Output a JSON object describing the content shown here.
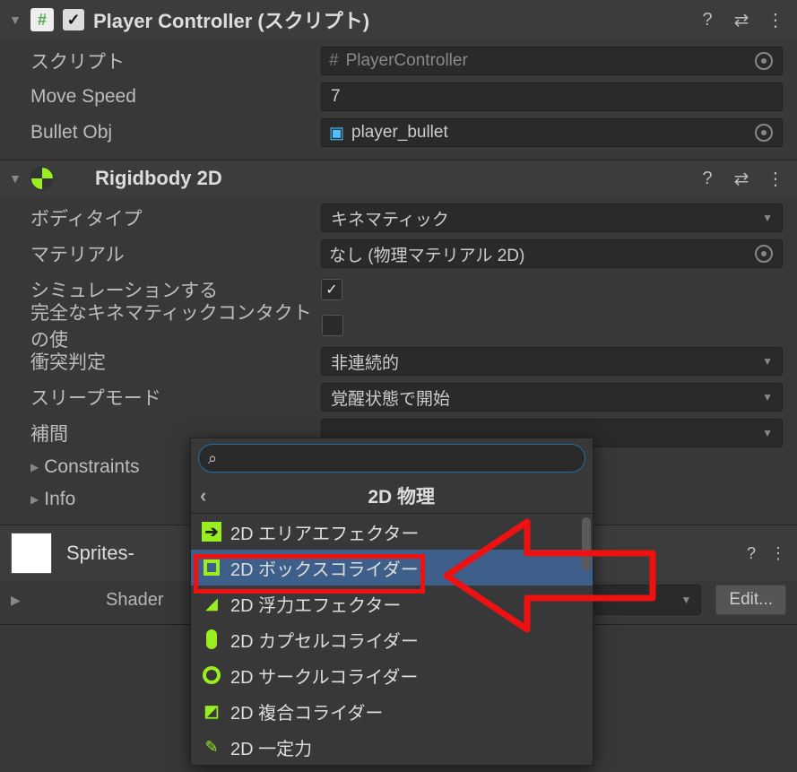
{
  "playerController": {
    "title": "Player Controller (スクリプト)",
    "scriptLabel": "スクリプト",
    "scriptValue": "PlayerController",
    "moveSpeedLabel": "Move Speed",
    "moveSpeedValue": "7",
    "bulletObjLabel": "Bullet Obj",
    "bulletObjValue": "player_bullet"
  },
  "rigidbody": {
    "title": "Rigidbody 2D",
    "bodyTypeLabel": "ボディタイプ",
    "bodyTypeValue": "キネマティック",
    "materialLabel": "マテリアル",
    "materialValue": "なし (物理マテリアル 2D)",
    "simulatedLabel": "シミュレーションする",
    "fullKinematicLabel": "完全なキネマティックコンタクトの使",
    "collisionLabel": "衝突判定",
    "collisionValue": "非連続的",
    "sleepLabel": "スリープモード",
    "sleepValue": "覚醒状態で開始",
    "interpLabel": "補間",
    "constraintsLabel": "Constraints",
    "infoLabel": "Info"
  },
  "material": {
    "title": "Sprites-",
    "shaderLabel": "Shader",
    "editLabel": "Edit..."
  },
  "popup": {
    "crumb": "2D 物理",
    "items": [
      "2D エリアエフェクター",
      "2D ボックスコライダー",
      "2D 浮力エフェクター",
      "2D カプセルコライダー",
      "2D サークルコライダー",
      "2D 複合コライダー",
      "2D 一定力"
    ],
    "selectedIndex": 1
  }
}
